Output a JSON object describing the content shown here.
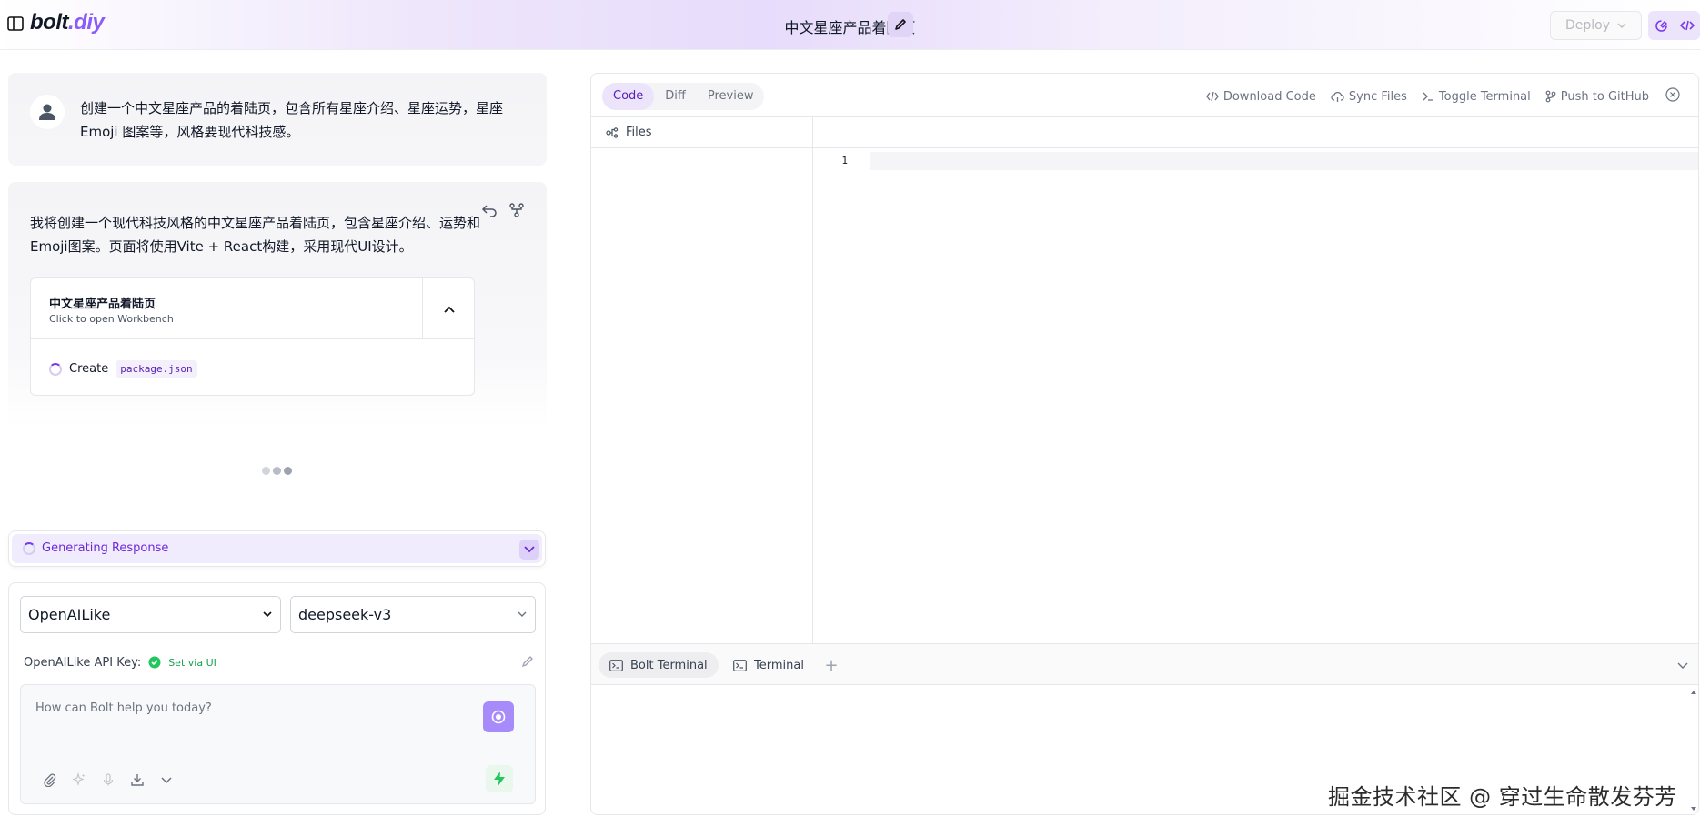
{
  "header": {
    "logo_main": "bolt",
    "logo_ext": ".diy",
    "project_title": "中文星座产品着陆页",
    "deploy_label": "Deploy"
  },
  "chat": {
    "user_message": "创建一个中文星座产品的着陆页，包含所有星座介绍、星座运势，星座 Emoji 图案等，风格要现代科技感。",
    "assistant_message": "我将创建一个现代科技风格的中文星座产品着陆页，包含星座介绍、运势和Emoji图案。页面将使用Vite + React构建，采用现代UI设计。",
    "artifact": {
      "title": "中文星座产品着陆页",
      "subtitle": "Click to open Workbench",
      "action_verb": "Create",
      "action_file": "package.json"
    },
    "status": "Generating Response"
  },
  "prompt": {
    "provider": "OpenAILike",
    "model": "deepseek-v3",
    "api_key_label": "OpenAILike API Key:",
    "api_key_status": "Set via UI",
    "placeholder": "How can Bolt help you today?",
    "value": ""
  },
  "workbench": {
    "tabs": [
      "Code",
      "Diff",
      "Preview"
    ],
    "active_tab": "Code",
    "actions": [
      "Download Code",
      "Sync Files",
      "Toggle Terminal",
      "Push to GitHub"
    ],
    "files_label": "Files",
    "line_numbers": [
      "1"
    ],
    "terminal_tabs": [
      "Bolt Terminal",
      "Terminal"
    ]
  },
  "watermark": "掘金技术社区 @ 穿过生命散发芬芳",
  "colors": {
    "accent": "#7c3aed",
    "accent_soft": "#ebe4fb",
    "success": "#16a34a",
    "record_button": "#a78bfa"
  }
}
